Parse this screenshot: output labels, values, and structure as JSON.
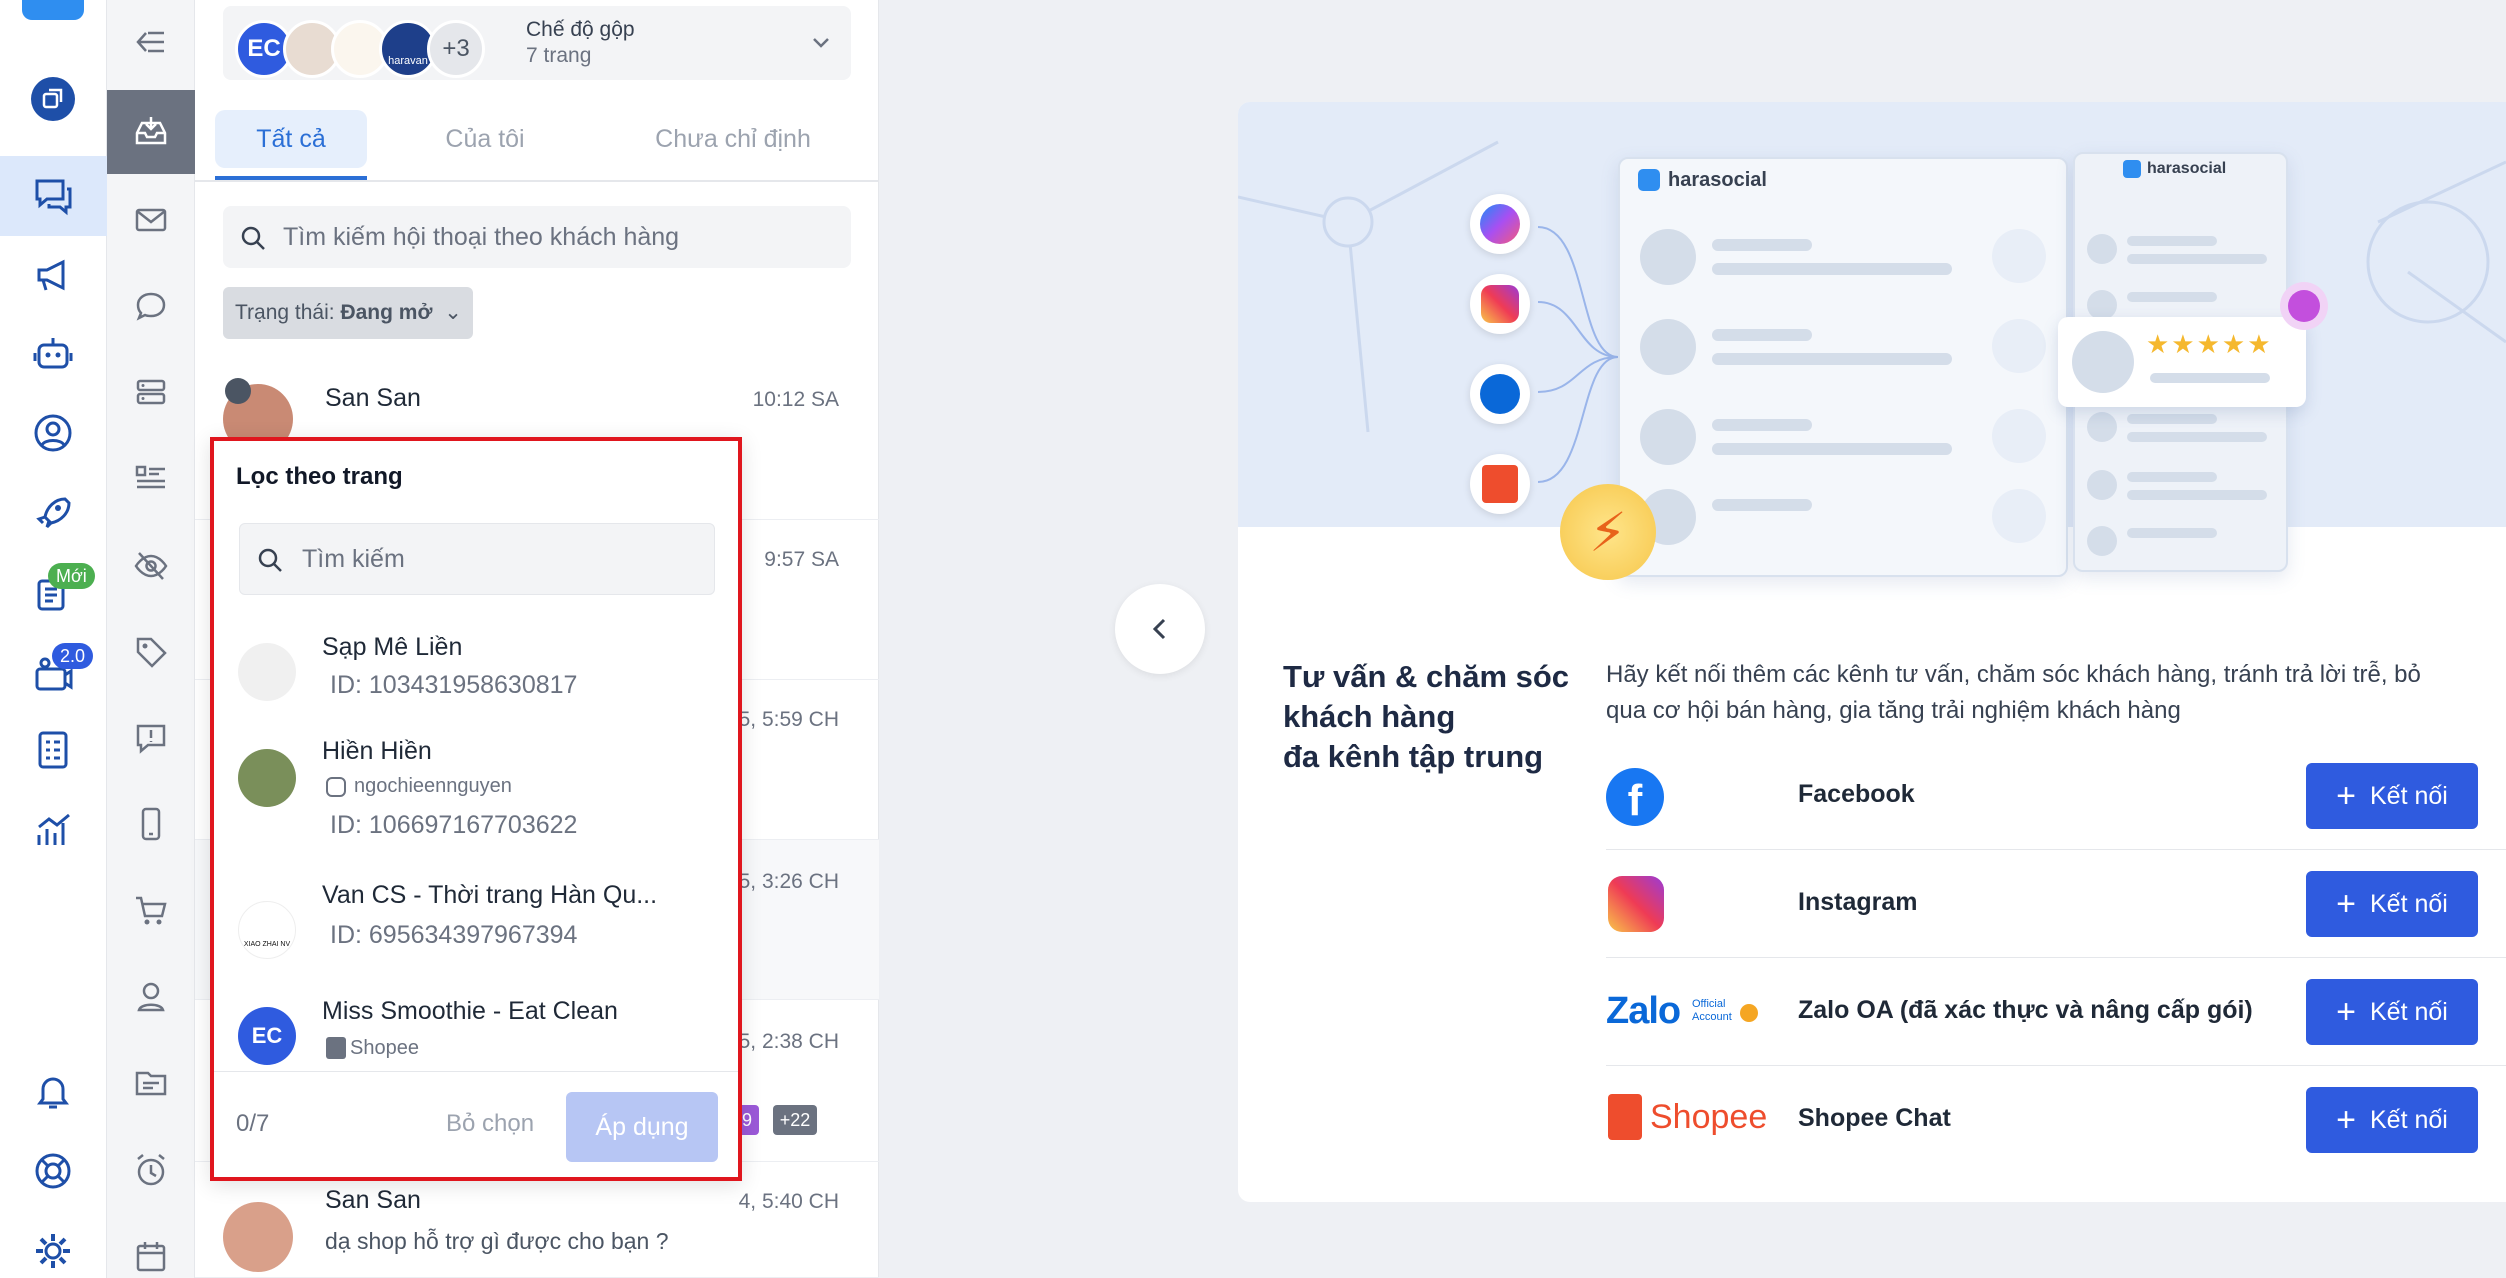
{
  "page_selector": {
    "avatar_initials": "EC",
    "more_count": "+3",
    "mode_title": "Chế độ gộp",
    "mode_subtitle": "7 trang",
    "avatar_brand": "haravan"
  },
  "tabs": [
    {
      "label": "Tất cả",
      "active": true
    },
    {
      "label": "Của tôi",
      "active": false
    },
    {
      "label": "Chưa chỉ định",
      "active": false
    }
  ],
  "search": {
    "placeholder": "Tìm kiếm hội thoại theo khách hàng"
  },
  "status_filter": {
    "label": "Trạng thái:",
    "value": "Đang mở"
  },
  "badges": {
    "new": "Mới",
    "version": "2.0"
  },
  "conversations": [
    {
      "name": "San San",
      "time": "10:12 SA",
      "preview": ""
    },
    {
      "name": "",
      "time": "9:57 SA",
      "preview": ""
    },
    {
      "name": "",
      "time": "5, 5:59 CH",
      "preview": ""
    },
    {
      "name": "",
      "time": "5, 3:26 CH",
      "preview": ""
    },
    {
      "name": "",
      "time": "5, 2:38 CH",
      "preview": "",
      "tags": [
        "9",
        "+22"
      ]
    },
    {
      "name": "San San",
      "time": "4, 5:40 CH",
      "preview": "dạ shop hỗ trợ gì được cho bạn ?"
    }
  ],
  "filter_popup": {
    "title": "Lọc theo trang",
    "search_placeholder": "Tìm kiếm",
    "items": [
      {
        "name": "Sạp Mê Liền",
        "id": "ID: 103431958630817"
      },
      {
        "name": "Hiền Hiền",
        "handle": "ngochieennguyen",
        "id": "ID: 106697167703622"
      },
      {
        "name": "Van CS - Thời trang Hàn Qu...",
        "id": "ID: 695634397967394",
        "avatar_text": "XIAO ZHAI NV"
      },
      {
        "name": "Miss Smoothie - Eat Clean",
        "platform": "Shopee",
        "avatar_initials": "EC"
      }
    ],
    "count": "0/7",
    "clear_label": "Bỏ chọn",
    "apply_label": "Áp dụng"
  },
  "main_card": {
    "illustration_brand": "harasocial",
    "title_lines": [
      "Tư vấn & chăm sóc",
      "khách hàng",
      "đa kênh tập trung"
    ],
    "description": "Hãy kết nối thêm các kênh tư vấn, chăm sóc khách hàng, tránh trả lời trễ, bỏ qua cơ hội bán hàng, gia tăng trải nghiệm khách hàng",
    "channels": [
      {
        "name": "Facebook",
        "button": "Kết nối"
      },
      {
        "name": "Instagram",
        "button": "Kết nối"
      },
      {
        "name": "Zalo OA (đã xác thực và nâng cấp gói)",
        "button": "Kết nối",
        "logo_text": "Zalo",
        "logo_sub": "Official Account"
      },
      {
        "name": "Shopee Chat",
        "button": "Kết nối",
        "logo_text": "Shopee"
      }
    ]
  },
  "colors": {
    "primary": "#2f5bdf",
    "nav_active": "#1e4fa8",
    "highlight_border": "#e0161e",
    "tab_active_text": "#2b6fd6"
  }
}
